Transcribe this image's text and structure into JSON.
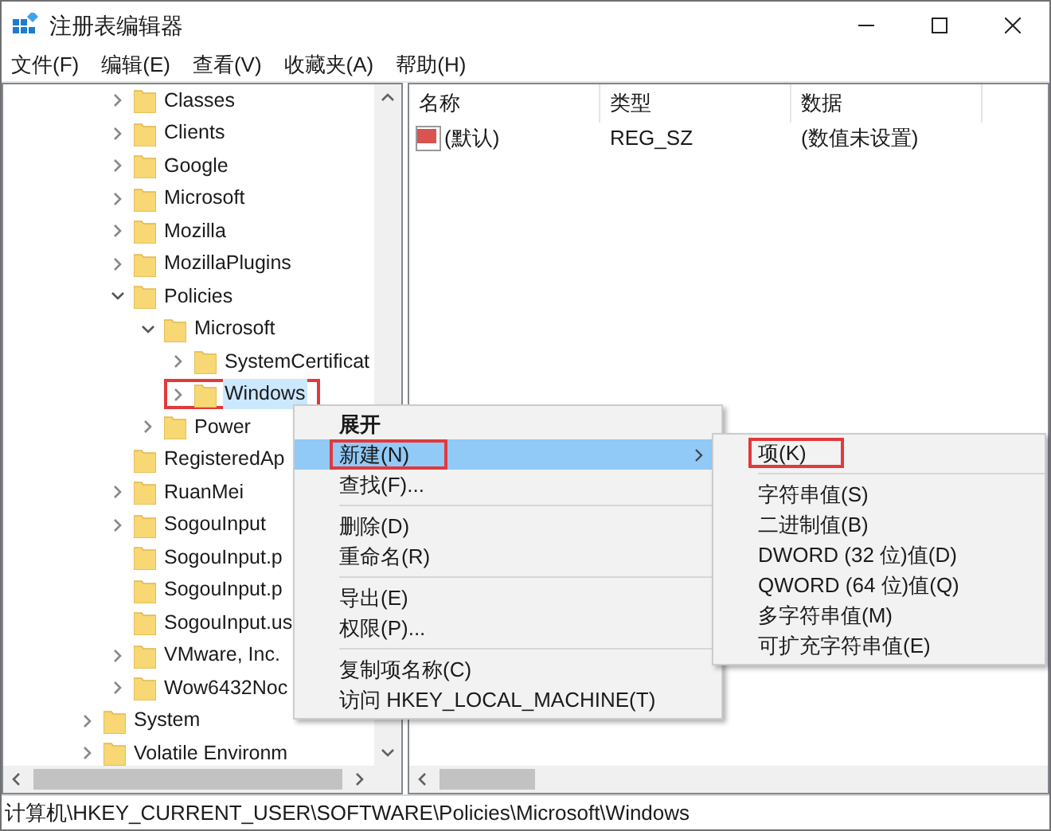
{
  "window": {
    "title": "注册表编辑器"
  },
  "menu_bar": [
    "文件(F)",
    "编辑(E)",
    "查看(V)",
    "收藏夹(A)",
    "帮助(H)"
  ],
  "tree": {
    "items": [
      {
        "children": [
          {
            "children": [
              {
                "label": "Classes",
                "expanded": false,
                "selected": false,
                "annotated": false
              },
              {
                "label": "Clients",
                "expanded": false,
                "selected": false,
                "annotated": false
              },
              {
                "label": "Google",
                "expanded": false,
                "selected": false,
                "annotated": false
              },
              {
                "label": "Microsoft",
                "expanded": false,
                "selected": false,
                "annotated": false
              },
              {
                "label": "Mozilla",
                "expanded": false,
                "selected": false,
                "annotated": false
              },
              {
                "label": "MozillaPlugins",
                "expanded": false,
                "selected": false,
                "annotated": false
              },
              {
                "label": "Policies",
                "expanded": true,
                "selected": false,
                "annotated": false,
                "children": [
                  {
                    "label": "Microsoft",
                    "expanded": true,
                    "selected": false,
                    "annotated": false,
                    "children": [
                      {
                        "label": "SystemCertificat",
                        "expanded": false,
                        "selected": false,
                        "annotated": false
                      },
                      {
                        "label": "Windows",
                        "expanded": false,
                        "selected": true,
                        "annotated": true
                      }
                    ]
                  },
                  {
                    "label": "Power",
                    "expanded": false,
                    "selected": false,
                    "annotated": false
                  }
                ]
              },
              {
                "label": "RegisteredAp",
                "selected": false,
                "annotated": false
              },
              {
                "label": "RuanMei",
                "expanded": false,
                "selected": false,
                "annotated": false
              },
              {
                "label": "SogouInput",
                "expanded": false,
                "selected": false,
                "annotated": false
              },
              {
                "label": "SogouInput.p",
                "selected": false,
                "annotated": false
              },
              {
                "label": "SogouInput.p",
                "selected": false,
                "annotated": false
              },
              {
                "label": "SogouInput.us",
                "selected": false,
                "annotated": false
              },
              {
                "label": "VMware, Inc.",
                "expanded": false,
                "selected": false,
                "annotated": false
              },
              {
                "label": "Wow6432Noc",
                "expanded": false,
                "selected": false,
                "annotated": false
              }
            ]
          },
          {
            "label": "System",
            "expanded": false,
            "selected": false,
            "annotated": false
          },
          {
            "label": "Volatile Environm",
            "expanded": false,
            "selected": false,
            "annotated": false
          }
        ]
      }
    ]
  },
  "values_list": {
    "columns": [
      "名称",
      "类型",
      "数据"
    ],
    "rows": [
      {
        "name": "(默认)",
        "type": "REG_SZ",
        "data": "(数值未设置)"
      }
    ]
  },
  "context_menu": {
    "items": [
      {
        "kind": "default",
        "label": "展开",
        "selected": false,
        "annotated": false
      },
      {
        "kind": "item",
        "label": "新建(N)",
        "submenu": true,
        "selected": true,
        "annotated": true
      },
      {
        "kind": "item",
        "label": "查找(F)...",
        "selected": false,
        "annotated": false
      },
      {
        "kind": "separator"
      },
      {
        "kind": "item",
        "label": "删除(D)",
        "selected": false,
        "annotated": false
      },
      {
        "kind": "item",
        "label": "重命名(R)",
        "selected": false,
        "annotated": false
      },
      {
        "kind": "separator"
      },
      {
        "kind": "item",
        "label": "导出(E)",
        "selected": false,
        "annotated": false
      },
      {
        "kind": "item",
        "label": "权限(P)...",
        "selected": false,
        "annotated": false
      },
      {
        "kind": "separator"
      },
      {
        "kind": "item",
        "label": "复制项名称(C)",
        "selected": false,
        "annotated": false
      },
      {
        "kind": "item",
        "label": "访问 HKEY_LOCAL_MACHINE(T)",
        "selected": false,
        "annotated": false
      }
    ]
  },
  "submenu": {
    "items": [
      {
        "kind": "item",
        "label": "项(K)",
        "selected": false,
        "annotated": true
      },
      {
        "kind": "separator"
      },
      {
        "kind": "item",
        "label": "字符串值(S)",
        "selected": false,
        "annotated": false
      },
      {
        "kind": "item",
        "label": "二进制值(B)",
        "selected": false,
        "annotated": false
      },
      {
        "kind": "item",
        "label": "DWORD (32 位)值(D)",
        "selected": false,
        "annotated": false
      },
      {
        "kind": "item",
        "label": "QWORD (64 位)值(Q)",
        "selected": false,
        "annotated": false
      },
      {
        "kind": "item",
        "label": "多字符串值(M)",
        "selected": false,
        "annotated": false
      },
      {
        "kind": "item",
        "label": "可扩充字符串值(E)",
        "selected": false,
        "annotated": false
      }
    ]
  },
  "status_bar": "计算机\\HKEY_CURRENT_USER\\SOFTWARE\\Policies\\Microsoft\\Windows"
}
